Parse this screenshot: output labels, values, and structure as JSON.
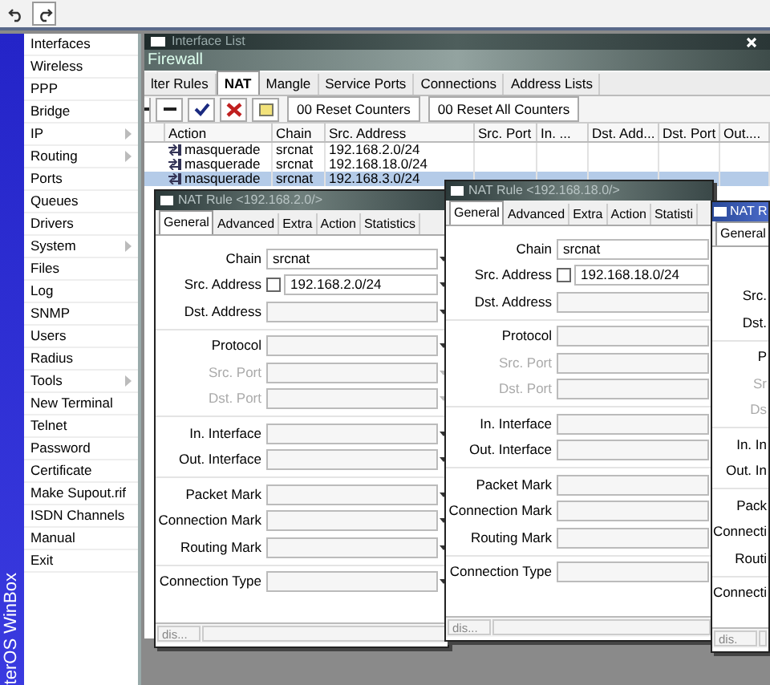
{
  "sidebar": {
    "brand": "terOS WinBox",
    "items": [
      {
        "label": "Interfaces",
        "submenu": false
      },
      {
        "label": "Wireless",
        "submenu": false
      },
      {
        "label": "PPP",
        "submenu": false
      },
      {
        "label": "Bridge",
        "submenu": false
      },
      {
        "label": "IP",
        "submenu": true
      },
      {
        "label": "Routing",
        "submenu": true
      },
      {
        "label": "Ports",
        "submenu": false
      },
      {
        "label": "Queues",
        "submenu": false
      },
      {
        "label": "Drivers",
        "submenu": false
      },
      {
        "label": "System",
        "submenu": true
      },
      {
        "label": "Files",
        "submenu": false
      },
      {
        "label": "Log",
        "submenu": false
      },
      {
        "label": "SNMP",
        "submenu": false
      },
      {
        "label": "Users",
        "submenu": false
      },
      {
        "label": "Radius",
        "submenu": false
      },
      {
        "label": "Tools",
        "submenu": true
      },
      {
        "label": "New Terminal",
        "submenu": false
      },
      {
        "label": "Telnet",
        "submenu": false
      },
      {
        "label": "Password",
        "submenu": false
      },
      {
        "label": "Certificate",
        "submenu": false
      },
      {
        "label": "Make Supout.rif",
        "submenu": false
      },
      {
        "label": "ISDN Channels",
        "submenu": false
      },
      {
        "label": "Manual",
        "submenu": false
      },
      {
        "label": "Exit",
        "submenu": false
      }
    ]
  },
  "background_window": {
    "title": "Interface List"
  },
  "firewall": {
    "title": "Firewall",
    "tabs": [
      {
        "label": "lter Rules",
        "selected": false
      },
      {
        "label": "NAT",
        "selected": true
      },
      {
        "label": "Mangle",
        "selected": false
      },
      {
        "label": "Service Ports",
        "selected": false
      },
      {
        "label": "Connections",
        "selected": false
      },
      {
        "label": "Address Lists",
        "selected": false
      }
    ],
    "buttons": [
      "00 Reset Counters",
      "00 Reset All Counters"
    ],
    "columns": [
      "Action",
      "Chain",
      "Src. Address",
      "Src. Port",
      "In. ...",
      "Dst. Add...",
      "Dst. Port",
      "Out...."
    ],
    "rows": [
      {
        "cells": [
          "masquerade",
          "srcnat",
          "192.168.2.0/24"
        ],
        "selected": false
      },
      {
        "cells": [
          "masquerade",
          "srcnat",
          "192.168.18.0/24"
        ],
        "selected": false
      },
      {
        "cells": [
          "masquerade",
          "srcnat",
          "192.168.3.0/24"
        ],
        "selected": true
      }
    ]
  },
  "rule_windows": [
    {
      "title": "NAT Rule <192.168.2.0/>",
      "tabs": [
        {
          "label": "General",
          "selected": true
        },
        {
          "label": "Advanced",
          "selected": false
        },
        {
          "label": "Extra",
          "selected": false
        },
        {
          "label": "Action",
          "selected": false
        },
        {
          "label": "Statistics",
          "selected": false
        }
      ],
      "groups": [
        [
          {
            "label": "Chain",
            "kind": "combo",
            "value": "srcnat",
            "disabled": false
          },
          {
            "label": "Src. Address",
            "kind": "negatable",
            "value": "192.168.2.0/24",
            "checked": false,
            "disabled": false
          },
          {
            "label": "Dst. Address",
            "kind": "combo",
            "disabled": false
          }
        ],
        [
          {
            "label": "Protocol",
            "kind": "combo",
            "disabled": false
          },
          {
            "label": "Src. Port",
            "kind": "combo",
            "disabled": true
          },
          {
            "label": "Dst. Port",
            "kind": "combo",
            "disabled": true
          }
        ],
        [
          {
            "label": "In. Interface",
            "kind": "combo",
            "disabled": false
          },
          {
            "label": "Out. Interface",
            "kind": "combo",
            "disabled": false
          }
        ],
        [
          {
            "label": "Packet Mark",
            "kind": "combo",
            "disabled": false
          },
          {
            "label": "Connection Mark",
            "kind": "combo",
            "disabled": false
          },
          {
            "label": "Routing Mark",
            "kind": "combo",
            "disabled": false
          }
        ],
        [
          {
            "label": "Connection Type",
            "kind": "combo",
            "disabled": false
          }
        ]
      ],
      "status": "dis..."
    },
    {
      "title": "NAT Rule <192.168.18.0/>",
      "tabs": [
        {
          "label": "General",
          "selected": true
        },
        {
          "label": "Advanced",
          "selected": false
        },
        {
          "label": "Extra",
          "selected": false
        },
        {
          "label": "Action",
          "selected": false
        },
        {
          "label": "Statisti",
          "selected": false
        }
      ],
      "groups": [
        [
          {
            "label": "Chain",
            "kind": "combo",
            "value": "srcnat",
            "disabled": false
          },
          {
            "label": "Src. Address",
            "kind": "negatable",
            "value": "192.168.18.0/24",
            "checked": false,
            "disabled": false
          },
          {
            "label": "Dst. Address",
            "kind": "combo",
            "disabled": false
          }
        ],
        [
          {
            "label": "Protocol",
            "kind": "combo",
            "disabled": false
          },
          {
            "label": "Src. Port",
            "kind": "combo",
            "disabled": true
          },
          {
            "label": "Dst. Port",
            "kind": "combo",
            "disabled": true
          }
        ],
        [
          {
            "label": "In. Interface",
            "kind": "combo",
            "disabled": false
          },
          {
            "label": "Out. Interface",
            "kind": "combo",
            "disabled": false
          }
        ],
        [
          {
            "label": "Packet Mark",
            "kind": "combo",
            "disabled": false
          },
          {
            "label": "Connection Mark",
            "kind": "combo",
            "disabled": false
          },
          {
            "label": "Routing Mark",
            "kind": "combo",
            "disabled": false
          }
        ],
        [
          {
            "label": "Connection Type",
            "kind": "combo",
            "disabled": false
          }
        ]
      ],
      "status": "dis..."
    },
    {
      "title": "NAT R",
      "tabs": [
        {
          "label": "General",
          "selected": true
        }
      ],
      "groups": [
        [
          {
            "kind": "offscreen"
          },
          {
            "label": "Src.",
            "kind": "label",
            "disabled": false
          },
          {
            "label": "Dst.",
            "kind": "label",
            "disabled": false
          }
        ],
        [
          {
            "label": "P",
            "kind": "label",
            "disabled": false
          },
          {
            "label": "Sr",
            "kind": "label",
            "disabled": true
          },
          {
            "label": "Ds",
            "kind": "label",
            "disabled": true
          }
        ],
        [
          {
            "label": "In. In",
            "kind": "label",
            "disabled": false
          },
          {
            "label": "Out. In",
            "kind": "label",
            "disabled": false
          }
        ],
        [
          {
            "label": "Pack",
            "kind": "label",
            "disabled": false
          },
          {
            "label": "Connecti",
            "kind": "label",
            "disabled": false
          },
          {
            "label": "Routi",
            "kind": "label",
            "disabled": false
          }
        ],
        [
          {
            "label": "Connecti",
            "kind": "label",
            "disabled": false
          }
        ]
      ],
      "status": "dis."
    }
  ]
}
